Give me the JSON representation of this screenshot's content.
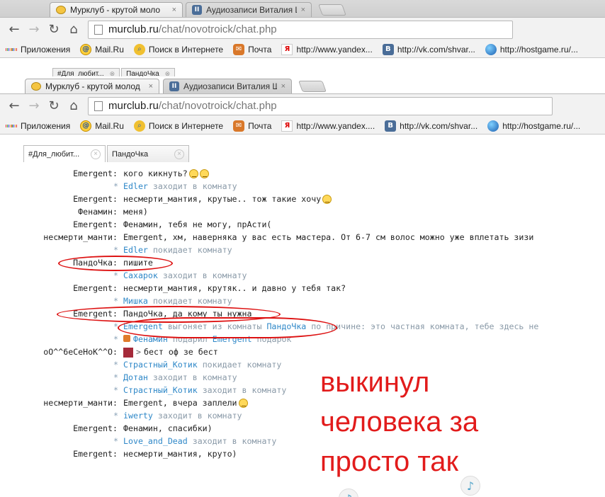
{
  "back_window": {
    "tabs": [
      {
        "label": "Мурклуб - крутой моло",
        "close": "×"
      },
      {
        "label": "Аудиозаписи Виталия Ш",
        "close": "×"
      }
    ],
    "url_host": "murclub.ru",
    "url_path": "/chat/novotroick/chat.php",
    "bookmarks": [
      "Приложения",
      "Mail.Ru",
      "Поиск в Интернете",
      "Почта",
      "http://www.yandex...",
      "http://vk.com/shvar...",
      "http://hostgame.ru/..."
    ],
    "inner_tabs": [
      "#Для_любит...",
      "ПандоЧка"
    ]
  },
  "front_window": {
    "tabs": [
      {
        "label": "Мурклуб - крутой молод",
        "close": "×"
      },
      {
        "label": "Аудиозаписи Виталия Ш",
        "close": "×"
      }
    ],
    "url_host": "murclub.ru",
    "url_path": "/chat/novotroick/chat.php",
    "bookmarks": [
      {
        "label": "Приложения",
        "icon": "apps-icon"
      },
      {
        "label": "Mail.Ru",
        "icon": "mailru-icon"
      },
      {
        "label": "Поиск в Интернете",
        "icon": "search-icon"
      },
      {
        "label": "Почта",
        "icon": "mail-icon"
      },
      {
        "label": "http://www.yandex....",
        "icon": "yandex-icon"
      },
      {
        "label": "http://vk.com/shvar...",
        "icon": "vk-icon"
      },
      {
        "label": "http://hostgame.ru/...",
        "icon": "globe-icon"
      }
    ]
  },
  "chat_tabs": [
    {
      "label": "#Для_любит...",
      "close": "×"
    },
    {
      "label": "ПандоЧка",
      "close": "×"
    }
  ],
  "messages": [
    {
      "type": "msg",
      "nick": "Emergent:",
      "text": "кого кикнуть?",
      "smileys": 2
    },
    {
      "type": "sys",
      "star": "*",
      "user": "Edler",
      "action": "заходит в комнату"
    },
    {
      "type": "msg",
      "nick": "Emergent:",
      "text": "несмерти_мантия, крутые.. тож такие хочу",
      "smileys": 1
    },
    {
      "type": "msg",
      "nick": "Фенамин:",
      "text": "меня)"
    },
    {
      "type": "msg",
      "nick": "Emergent:",
      "text": "Фенамин, тебя не могу, прАсти("
    },
    {
      "type": "msg",
      "nick": "несмерти_манти:",
      "text": "Emergent, хм, наверняка у вас есть мастера. От 6-7 см волос можно уже вплетать зизи"
    },
    {
      "type": "sys",
      "star": "*",
      "user": "Edler",
      "action": "покидает комнату"
    },
    {
      "type": "msg",
      "nick": "ПандоЧка:",
      "text": "пишите"
    },
    {
      "type": "sys",
      "star": "*",
      "user": "Сахарок",
      "action": "заходит в комнату"
    },
    {
      "type": "msg",
      "nick": "Emergent:",
      "text": "несмерти_мантия, крутяк.. и давно у тебя так?"
    },
    {
      "type": "sys",
      "star": "*",
      "user": "Мишка",
      "action": "покидает комнату"
    },
    {
      "type": "msg",
      "nick": "Emergent:",
      "text": "ПандоЧка, да кому ты нужна"
    },
    {
      "type": "kick",
      "star": "*",
      "user": "Emergent",
      "action": "выгоняет из комнаты",
      "target": "ПандоЧка",
      "reason": "по причине: это частная комната, тебе здесь не"
    },
    {
      "type": "gift",
      "star": "*",
      "user": "Фенамин",
      "action": "подарил",
      "target": "Emergent",
      "tail": "подарок"
    },
    {
      "type": "msg",
      "nick": "oO^^6eCeHoK^^O:",
      "text": "бест оф зе бест",
      "avatar": true,
      "arrow": ">"
    },
    {
      "type": "sys",
      "star": "*",
      "user": "Страстный_Котик",
      "action": "покидает комнату"
    },
    {
      "type": "sys",
      "star": "*",
      "user": "Дотан",
      "action": "заходит в комнату"
    },
    {
      "type": "sys",
      "star": "*",
      "user": "Страстный_Котик",
      "action": "заходит в комнату"
    },
    {
      "type": "msg",
      "nick": "несмерти_манти:",
      "text": "Emergent, вчера заплели",
      "smileys": 1
    },
    {
      "type": "sys",
      "star": "*",
      "user": "iwerty",
      "action": "заходит в комнату"
    },
    {
      "type": "msg",
      "nick": "Emergent:",
      "text": "Фенамин, спасибки)"
    },
    {
      "type": "sys",
      "star": "*",
      "user": "Love_and_Dead",
      "action": "заходит в комнату"
    },
    {
      "type": "msg",
      "nick": "Emergent:",
      "text": "несмерти_мантия, круто)"
    }
  ],
  "annotation": {
    "lines": [
      "выкинул",
      "человека за",
      "просто так"
    ],
    "color": "#e21b1b"
  },
  "colors": {
    "system_user": "#2f88c8",
    "system_text": "#8a9aa8",
    "annotation_red": "#d11111"
  }
}
